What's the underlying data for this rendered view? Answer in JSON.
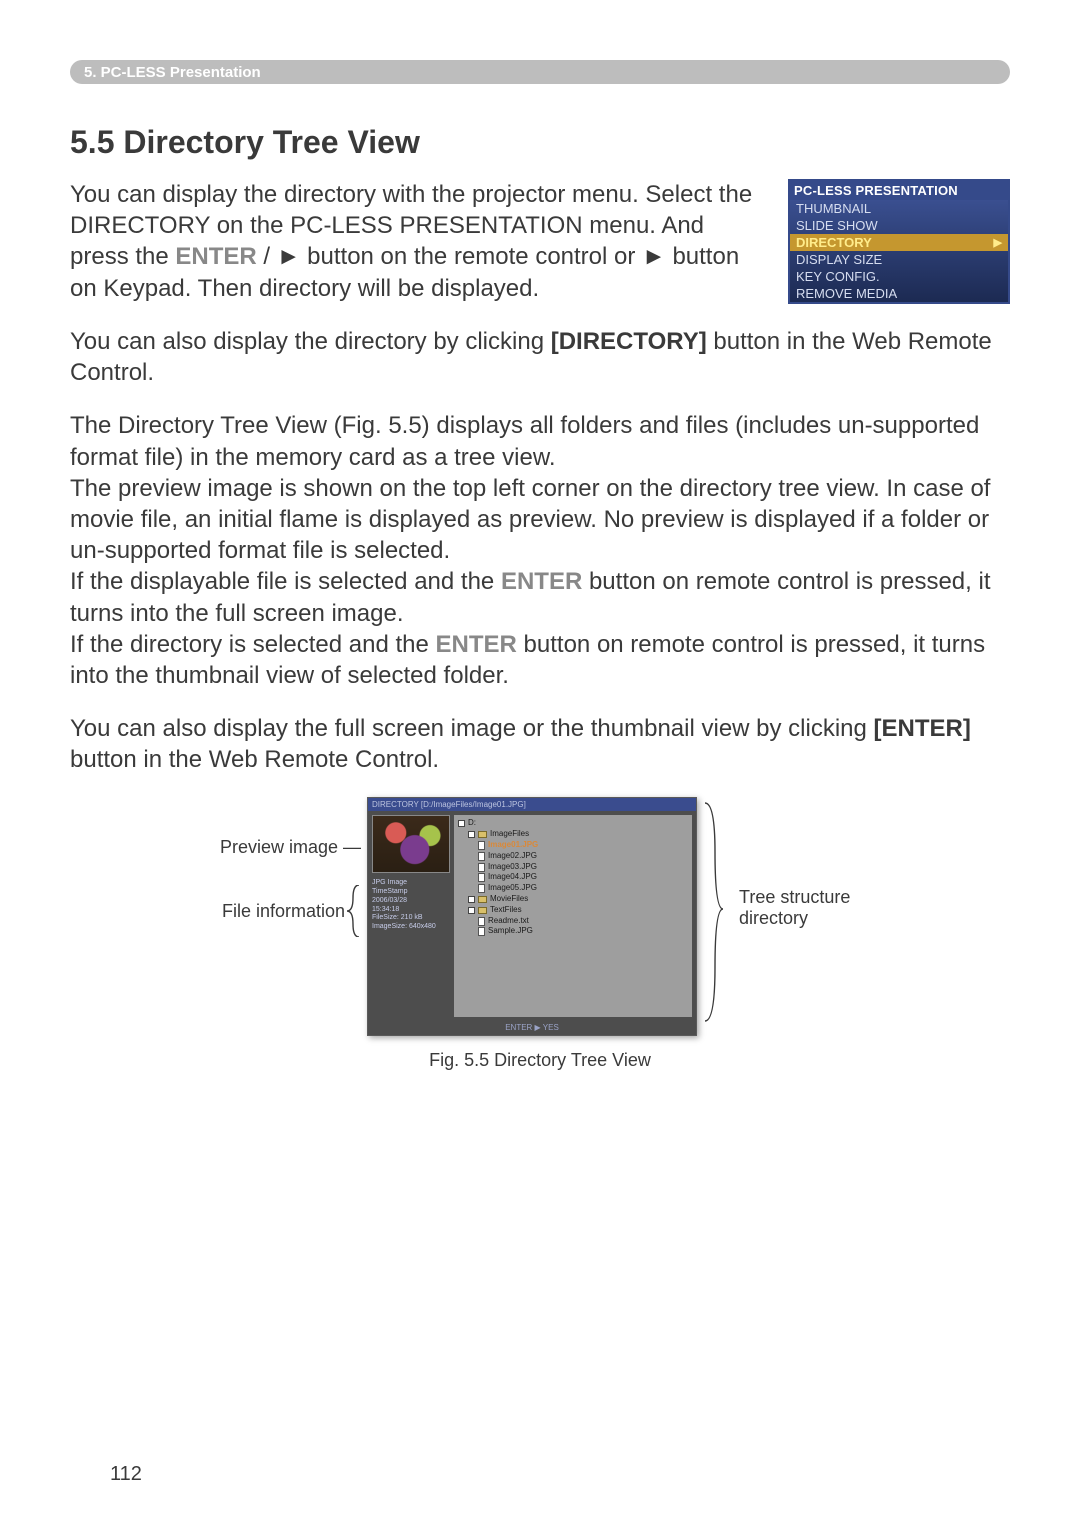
{
  "header": {
    "section": "5. PC-LESS Presentation"
  },
  "title": "5.5 Directory Tree View",
  "intro": {
    "line1a": "You can display the directory with the projector menu. Select the DIRECTORY on the PC-LESS PRESENTATION menu. And press the ",
    "enter": "ENTER",
    "line1b": " / ► button on the remote control or ► button on Keypad. Then directory will be displayed."
  },
  "para2a": "You can also display the directory by clicking ",
  "directory_btn": "[DIRECTORY]",
  "para2b": " button in the Web Remote Control.",
  "para3a": "The Directory Tree View (Fig. 5.5) displays all folders and files (includes un-supported format file) in the memory card as a tree view.",
  "para3b": "The preview image is shown on the top left corner on the directory tree view. In case of movie file, an initial flame is displayed as preview. No preview is displayed if a folder or un-supported format file is selected.",
  "para3c_a": "If the displayable file is selected and the ",
  "para3c_b": " button on remote control is pressed, it turns into the full screen image.",
  "para3d_a": "If the directory is selected and the ",
  "para3d_b": " button on remote control is pressed, it turns into the thumbnail view of selected folder.",
  "para4a": "You can also display the full screen image or the thumbnail view by clicking ",
  "enter_btn": "[ENTER]",
  "para4b": " button in the Web Remote Control.",
  "menu": {
    "title": "PC-LESS PRESENTATION",
    "items": [
      {
        "label": "THUMBNAIL",
        "selected": false
      },
      {
        "label": "SLIDE SHOW",
        "selected": false
      },
      {
        "label": "DIRECTORY",
        "selected": true
      },
      {
        "label": "DISPLAY SIZE",
        "selected": false
      },
      {
        "label": "KEY CONFIG.",
        "selected": false
      },
      {
        "label": "REMOVE MEDIA",
        "selected": false
      }
    ]
  },
  "annotations": {
    "preview": "Preview image",
    "fileinfo": "File information",
    "tree": "Tree structure directory"
  },
  "dirshot": {
    "path": "DIRECTORY   [D:/ImageFiles/Image01.JPG]",
    "root": "D:",
    "folder1": "ImageFiles",
    "files1": [
      "Image01.JPG",
      "Image02.JPG",
      "Image03.JPG",
      "Image04.JPG",
      "Image05.JPG"
    ],
    "folder2": "MovieFiles",
    "folder3": "TextFiles",
    "files3": [
      "Readme.txt",
      "Sample.JPG"
    ],
    "info": [
      "JPG Image",
      "TimeStamp",
      "2006/03/28",
      "15:34:18",
      "FileSize: 210 kB",
      "ImageSize: 640x480"
    ],
    "footer": "ENTER ▶ YES"
  },
  "caption": "Fig. 5.5 Directory Tree View",
  "pagenum": "112"
}
